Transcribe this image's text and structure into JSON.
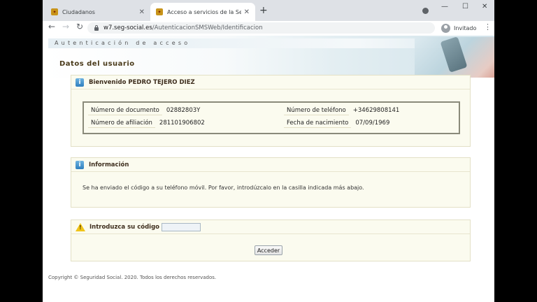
{
  "browser": {
    "tabs": [
      {
        "title": "Ciudadanos",
        "favicon": "seg-social-favicon"
      },
      {
        "title": "Acceso a servicios de la Seguridad",
        "favicon": "seg-social-favicon"
      }
    ],
    "new_tab_glyph": "+",
    "url_host": "w7.seg-social.es",
    "url_path": "/AutenticacionSMSWeb/Identificacion",
    "profile_label": "Invitado"
  },
  "banner": {
    "title": "Autenticación de acceso"
  },
  "section_title": "Datos del usuario",
  "welcome": {
    "heading": "Bienvenido PEDRO TEJERO DIEZ",
    "fields": {
      "documento_label": "Número de documento",
      "documento_value": "02882803Y",
      "afiliacion_label": "Número de afiliación",
      "afiliacion_value": "281101906802",
      "telefono_label": "Número de teléfono",
      "telefono_value": "+34629808141",
      "nacimiento_label": "Fecha de nacimiento",
      "nacimiento_value": "07/09/1969"
    }
  },
  "info": {
    "heading": "Información",
    "message": "Se ha enviado el código a su teléfono móvil. Por favor, introdúzcalo en la casilla indicada más abajo."
  },
  "code": {
    "heading": "Introduzca su código",
    "input_value": "",
    "submit_label": "Acceder"
  },
  "footer": "Copyright © Seguridad Social. 2020. Todos los derechos reservados.",
  "colors": {
    "panel_bg": "#fbfbef",
    "info_icon": "#2f7fbe",
    "warning_icon": "#f0c419"
  }
}
